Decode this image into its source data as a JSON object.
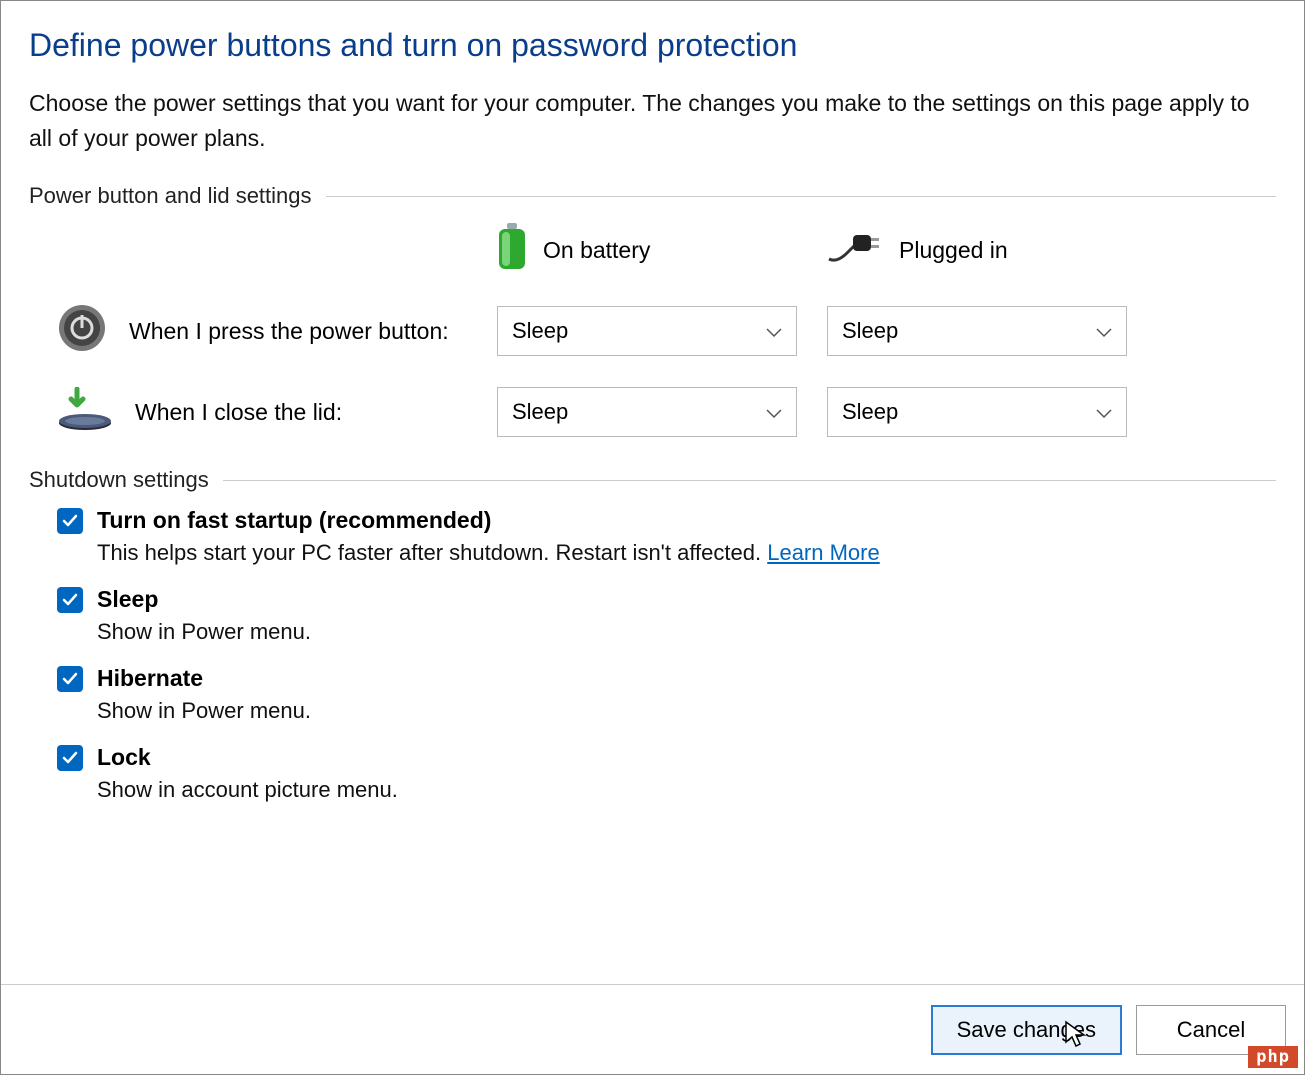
{
  "title": "Define power buttons and turn on password protection",
  "description": "Choose the power settings that you want for your computer. The changes you make to the settings on this page apply to all of your power plans.",
  "sections": {
    "power_lid": {
      "header": "Power button and lid settings",
      "columns": {
        "battery": "On battery",
        "plugged": "Plugged in"
      },
      "rows": [
        {
          "label": "When I press the power button:",
          "battery_value": "Sleep",
          "plugged_value": "Sleep"
        },
        {
          "label": "When I close the lid:",
          "battery_value": "Sleep",
          "plugged_value": "Sleep"
        }
      ]
    },
    "shutdown": {
      "header": "Shutdown settings",
      "items": [
        {
          "label": "Turn on fast startup (recommended)",
          "sub": "This helps start your PC faster after shutdown. Restart isn't affected. ",
          "link": "Learn More"
        },
        {
          "label": "Sleep",
          "sub": "Show in Power menu."
        },
        {
          "label": "Hibernate",
          "sub": "Show in Power menu."
        },
        {
          "label": "Lock",
          "sub": "Show in account picture menu."
        }
      ]
    }
  },
  "footer": {
    "save": "Save changes",
    "cancel": "Cancel"
  },
  "watermark": "php"
}
